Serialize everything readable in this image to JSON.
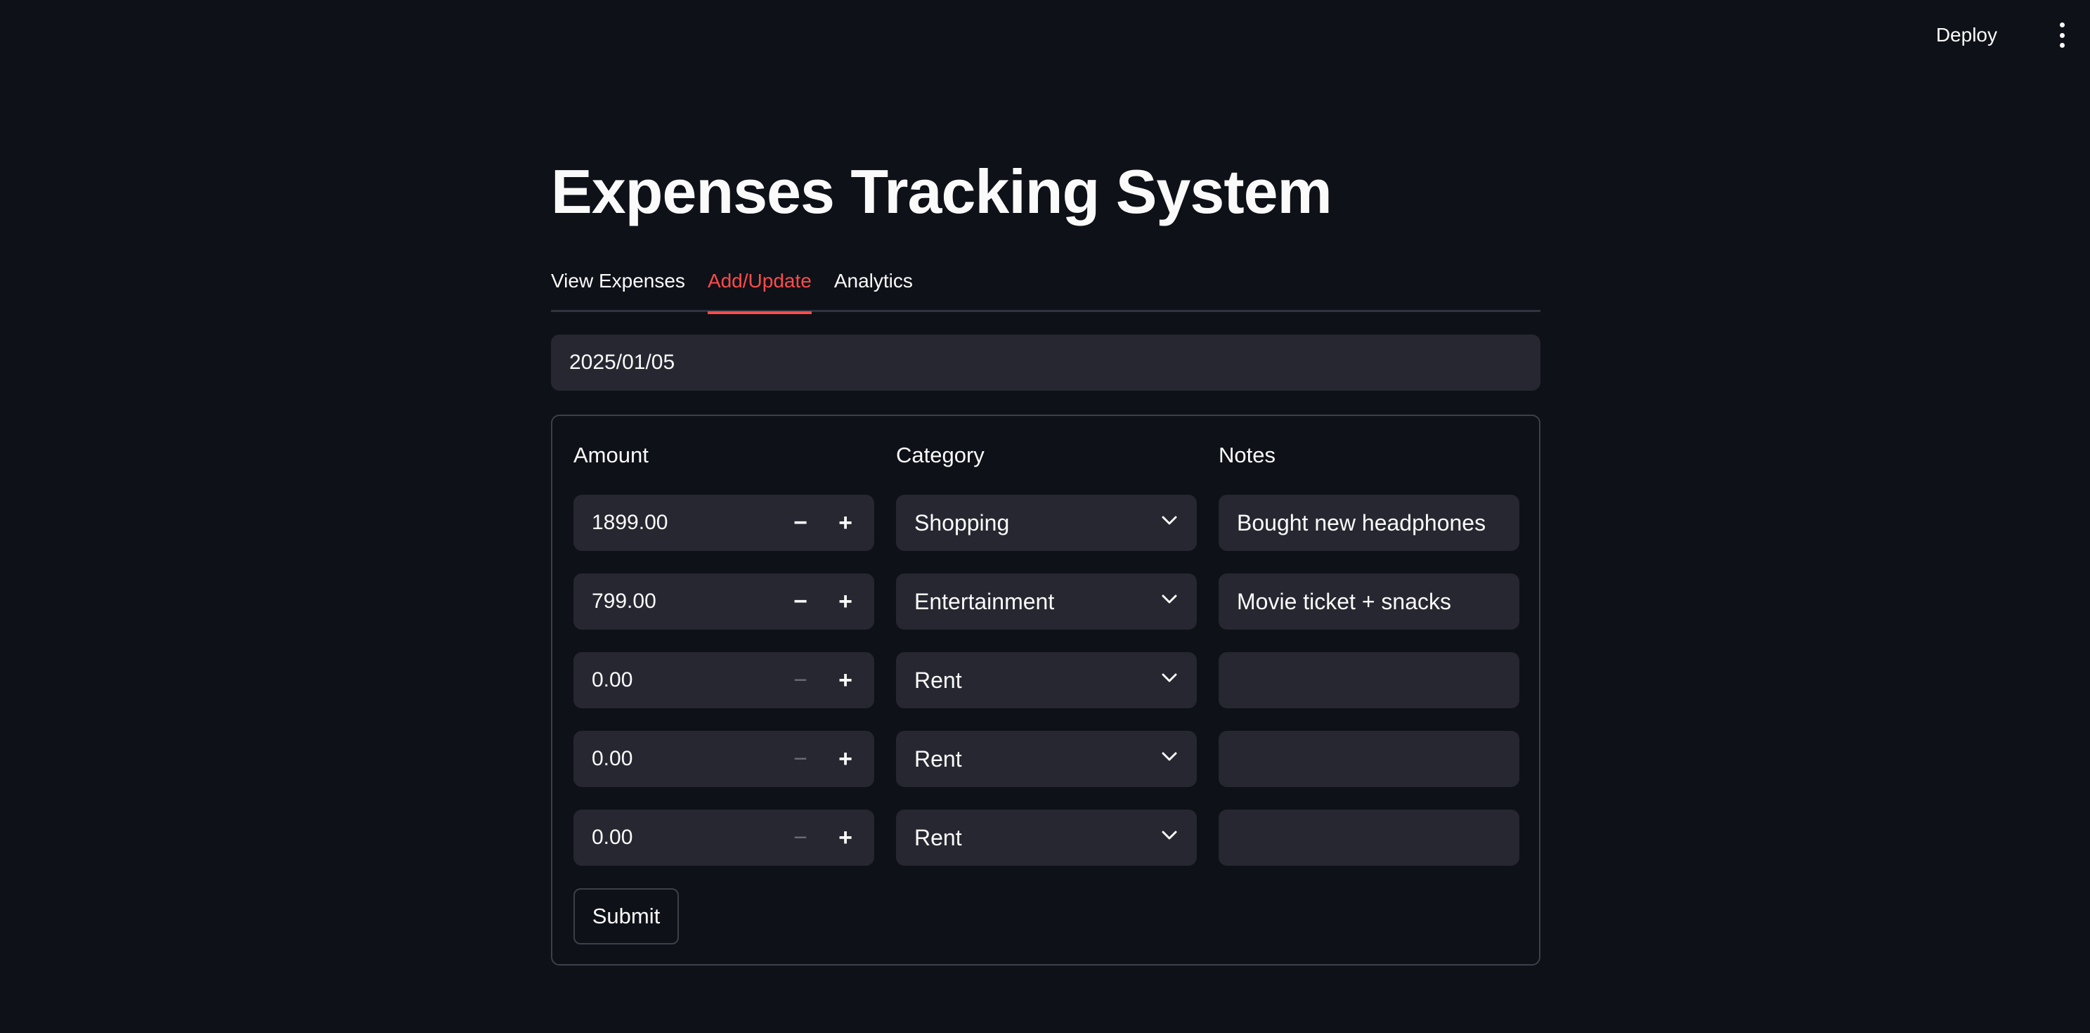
{
  "header": {
    "deploy_label": "Deploy"
  },
  "page": {
    "title": "Expenses Tracking System"
  },
  "tabs": [
    {
      "label": "View Expenses",
      "active": false
    },
    {
      "label": "Add/Update",
      "active": true
    },
    {
      "label": "Analytics",
      "active": false
    }
  ],
  "date_input": {
    "value": "2025/01/05"
  },
  "form": {
    "columns": {
      "amount": "Amount",
      "category": "Category",
      "notes": "Notes"
    },
    "rows": [
      {
        "amount": "1899.00",
        "category": "Shopping",
        "notes": "Bought new headphones"
      },
      {
        "amount": "799.00",
        "category": "Entertainment",
        "notes": "Movie ticket + snacks"
      },
      {
        "amount": "0.00",
        "category": "Rent",
        "notes": ""
      },
      {
        "amount": "0.00",
        "category": "Rent",
        "notes": ""
      },
      {
        "amount": "0.00",
        "category": "Rent",
        "notes": ""
      }
    ],
    "submit_label": "Submit"
  },
  "colors": {
    "background": "#0e1117",
    "field": "#262730",
    "accent": "#ff4b4b",
    "text": "#fafafa"
  }
}
